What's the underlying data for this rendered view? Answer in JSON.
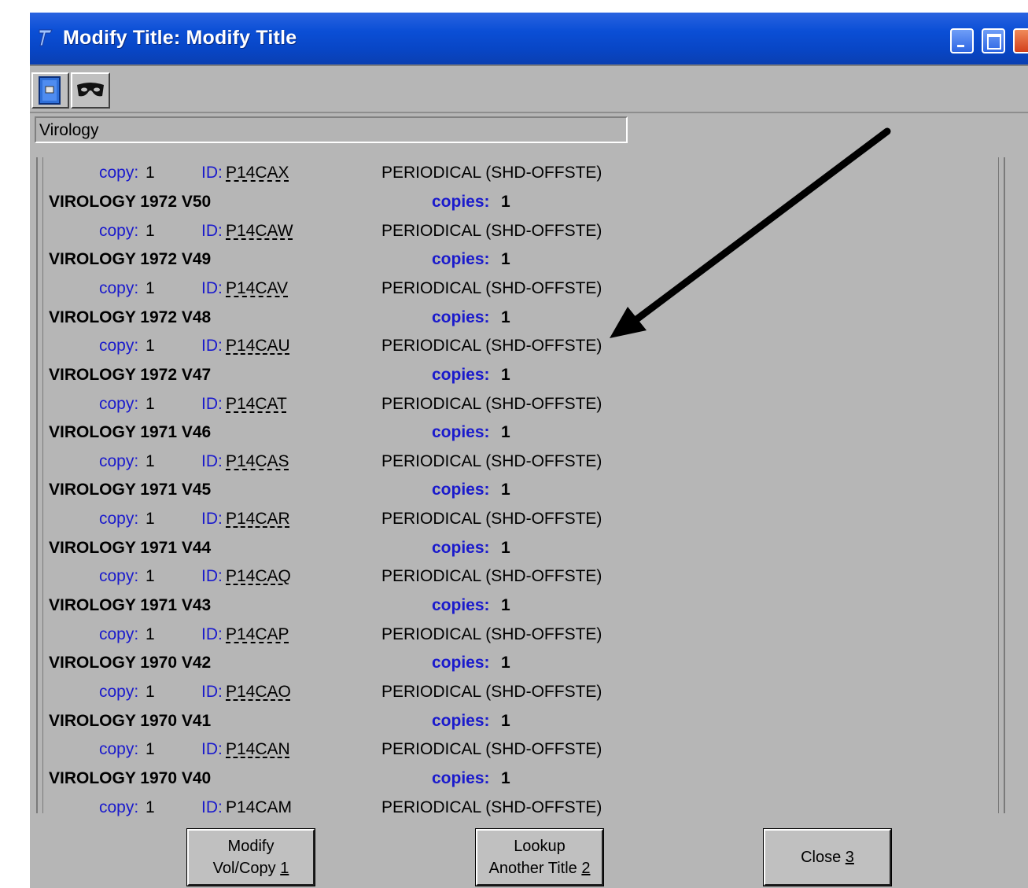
{
  "window": {
    "title": "Modify Title: Modify Title"
  },
  "record": {
    "title_field": "Virology"
  },
  "list": {
    "first_row": {
      "copy_label": "copy:",
      "copy_num": "1",
      "id_label": "ID:",
      "id": "P14CAX",
      "status": "PERIODICAL (SHD-OFFSTE)"
    },
    "volumes": [
      {
        "title": "VIROLOGY 1972 V50",
        "copies_label": "copies:",
        "copies": "1",
        "copy_label": "copy:",
        "copy_num": "1",
        "id_label": "ID:",
        "id": "P14CAW",
        "status": "PERIODICAL (SHD-OFFSTE)"
      },
      {
        "title": "VIROLOGY 1972 V49",
        "copies_label": "copies:",
        "copies": "1",
        "copy_label": "copy:",
        "copy_num": "1",
        "id_label": "ID:",
        "id": "P14CAV",
        "status": "PERIODICAL (SHD-OFFSTE)"
      },
      {
        "title": "VIROLOGY 1972 V48",
        "copies_label": "copies:",
        "copies": "1",
        "copy_label": "copy:",
        "copy_num": "1",
        "id_label": "ID:",
        "id": "P14CAU",
        "status": "PERIODICAL (SHD-OFFSTE)"
      },
      {
        "title": "VIROLOGY 1972 V47",
        "copies_label": "copies:",
        "copies": "1",
        "copy_label": "copy:",
        "copy_num": "1",
        "id_label": "ID:",
        "id": "P14CAT",
        "status": "PERIODICAL (SHD-OFFSTE)"
      },
      {
        "title": "VIROLOGY 1971 V46",
        "copies_label": "copies:",
        "copies": "1",
        "copy_label": "copy:",
        "copy_num": "1",
        "id_label": "ID:",
        "id": "P14CAS",
        "status": "PERIODICAL (SHD-OFFSTE)"
      },
      {
        "title": "VIROLOGY 1971 V45",
        "copies_label": "copies:",
        "copies": "1",
        "copy_label": "copy:",
        "copy_num": "1",
        "id_label": "ID:",
        "id": "P14CAR",
        "status": "PERIODICAL (SHD-OFFSTE)"
      },
      {
        "title": "VIROLOGY 1971 V44",
        "copies_label": "copies:",
        "copies": "1",
        "copy_label": "copy:",
        "copy_num": "1",
        "id_label": "ID:",
        "id": "P14CAQ",
        "status": "PERIODICAL (SHD-OFFSTE)"
      },
      {
        "title": "VIROLOGY 1971 V43",
        "copies_label": "copies:",
        "copies": "1",
        "copy_label": "copy:",
        "copy_num": "1",
        "id_label": "ID:",
        "id": "P14CAP",
        "status": "PERIODICAL (SHD-OFFSTE)"
      },
      {
        "title": "VIROLOGY 1970 V42",
        "copies_label": "copies:",
        "copies": "1",
        "copy_label": "copy:",
        "copy_num": "1",
        "id_label": "ID:",
        "id": "P14CAO",
        "status": "PERIODICAL (SHD-OFFSTE)"
      },
      {
        "title": "VIROLOGY 1970 V41",
        "copies_label": "copies:",
        "copies": "1",
        "copy_label": "copy:",
        "copy_num": "1",
        "id_label": "ID:",
        "id": "P14CAN",
        "status": "PERIODICAL (SHD-OFFSTE)"
      },
      {
        "title": "VIROLOGY 1970 V40",
        "copies_label": "copies:",
        "copies": "1",
        "copy_label": "copy:",
        "copy_num": "1",
        "id_label": "ID:",
        "id": "P14CAM",
        "status": "PERIODICAL (SHD-OFFSTE)"
      }
    ]
  },
  "buttons": {
    "modify": {
      "line1": "Modify",
      "line2_text": "Vol/Copy ",
      "line2_key": "1"
    },
    "lookup": {
      "line1": "Lookup",
      "line2_text": "Another Title ",
      "line2_key": "2"
    },
    "close": {
      "text": "Close ",
      "key": "3"
    }
  },
  "icons": {
    "toolbar_1": "book-icon",
    "toolbar_2": "mask-icon"
  }
}
